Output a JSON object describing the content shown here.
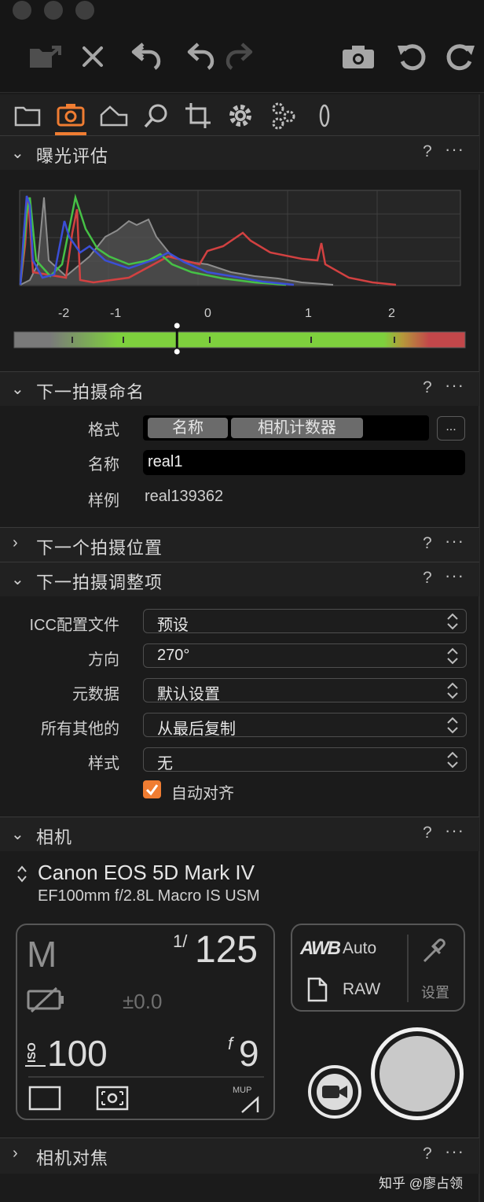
{
  "toolbar": {
    "icons": [
      "import-icon",
      "delete-icon",
      "undo-icon",
      "rotate-left-icon",
      "redo-icon",
      "camera-icon",
      "rotate-ccw-icon",
      "rotate-cw-icon"
    ]
  },
  "tabs": {
    "active": "capture-tab",
    "items": [
      "library-tab",
      "capture-tab",
      "adjust-tab",
      "search-tab",
      "crop-tab",
      "settings-tab",
      "gears-tab",
      "lens-tab"
    ]
  },
  "sections": {
    "exposure": {
      "title": "曝光评估",
      "help": "?",
      "more": "···"
    },
    "naming": {
      "title": "下一拍摄命名",
      "help": "?",
      "more": "···"
    },
    "location": {
      "title": "下一个拍摄位置",
      "help": "?",
      "more": "···"
    },
    "adjust": {
      "title": "下一拍摄调整项",
      "help": "?",
      "more": "···"
    },
    "camera": {
      "title": "相机",
      "help": "?",
      "more": "···"
    },
    "focus": {
      "title": "相机对焦",
      "help": "?",
      "more": "···"
    }
  },
  "exposure": {
    "scale_labels": [
      "-2",
      "-1",
      "0",
      "1",
      "2"
    ],
    "meter_value": -0.7
  },
  "naming": {
    "format_label": "格式",
    "format_tokens": [
      "名称",
      "相机计数器"
    ],
    "format_more": "...",
    "name_label": "名称",
    "name_value": "real1",
    "sample_label": "样例",
    "sample_value": "real139362"
  },
  "adjust": {
    "rows": [
      {
        "label": "ICC配置文件",
        "value": "预设"
      },
      {
        "label": "方向",
        "value": "270°"
      },
      {
        "label": "元数据",
        "value": "默认设置"
      },
      {
        "label": "所有其他的",
        "value": "从最后复制"
      },
      {
        "label": "样式",
        "value": "无"
      }
    ],
    "autoalign_label": "自动对齐",
    "autoalign_checked": true
  },
  "camera": {
    "model": "Canon EOS 5D Mark IV",
    "lens": "EF100mm f/2.8L Macro IS USM",
    "mode": "M",
    "shutter_num": "1/",
    "shutter_den": "125",
    "ev": "±0.0",
    "iso_label": "ISO",
    "iso": "100",
    "aperture_label": "f",
    "aperture": "9",
    "mup": "MUP",
    "wb_badge": "AWB",
    "wb_value": "Auto",
    "format": "RAW",
    "settings_label": "设置"
  },
  "watermark": "知乎 @廖占领",
  "colors": {
    "accent": "#f07d32",
    "meter_green": "#7ed03d",
    "meter_red": "#c2474a"
  }
}
